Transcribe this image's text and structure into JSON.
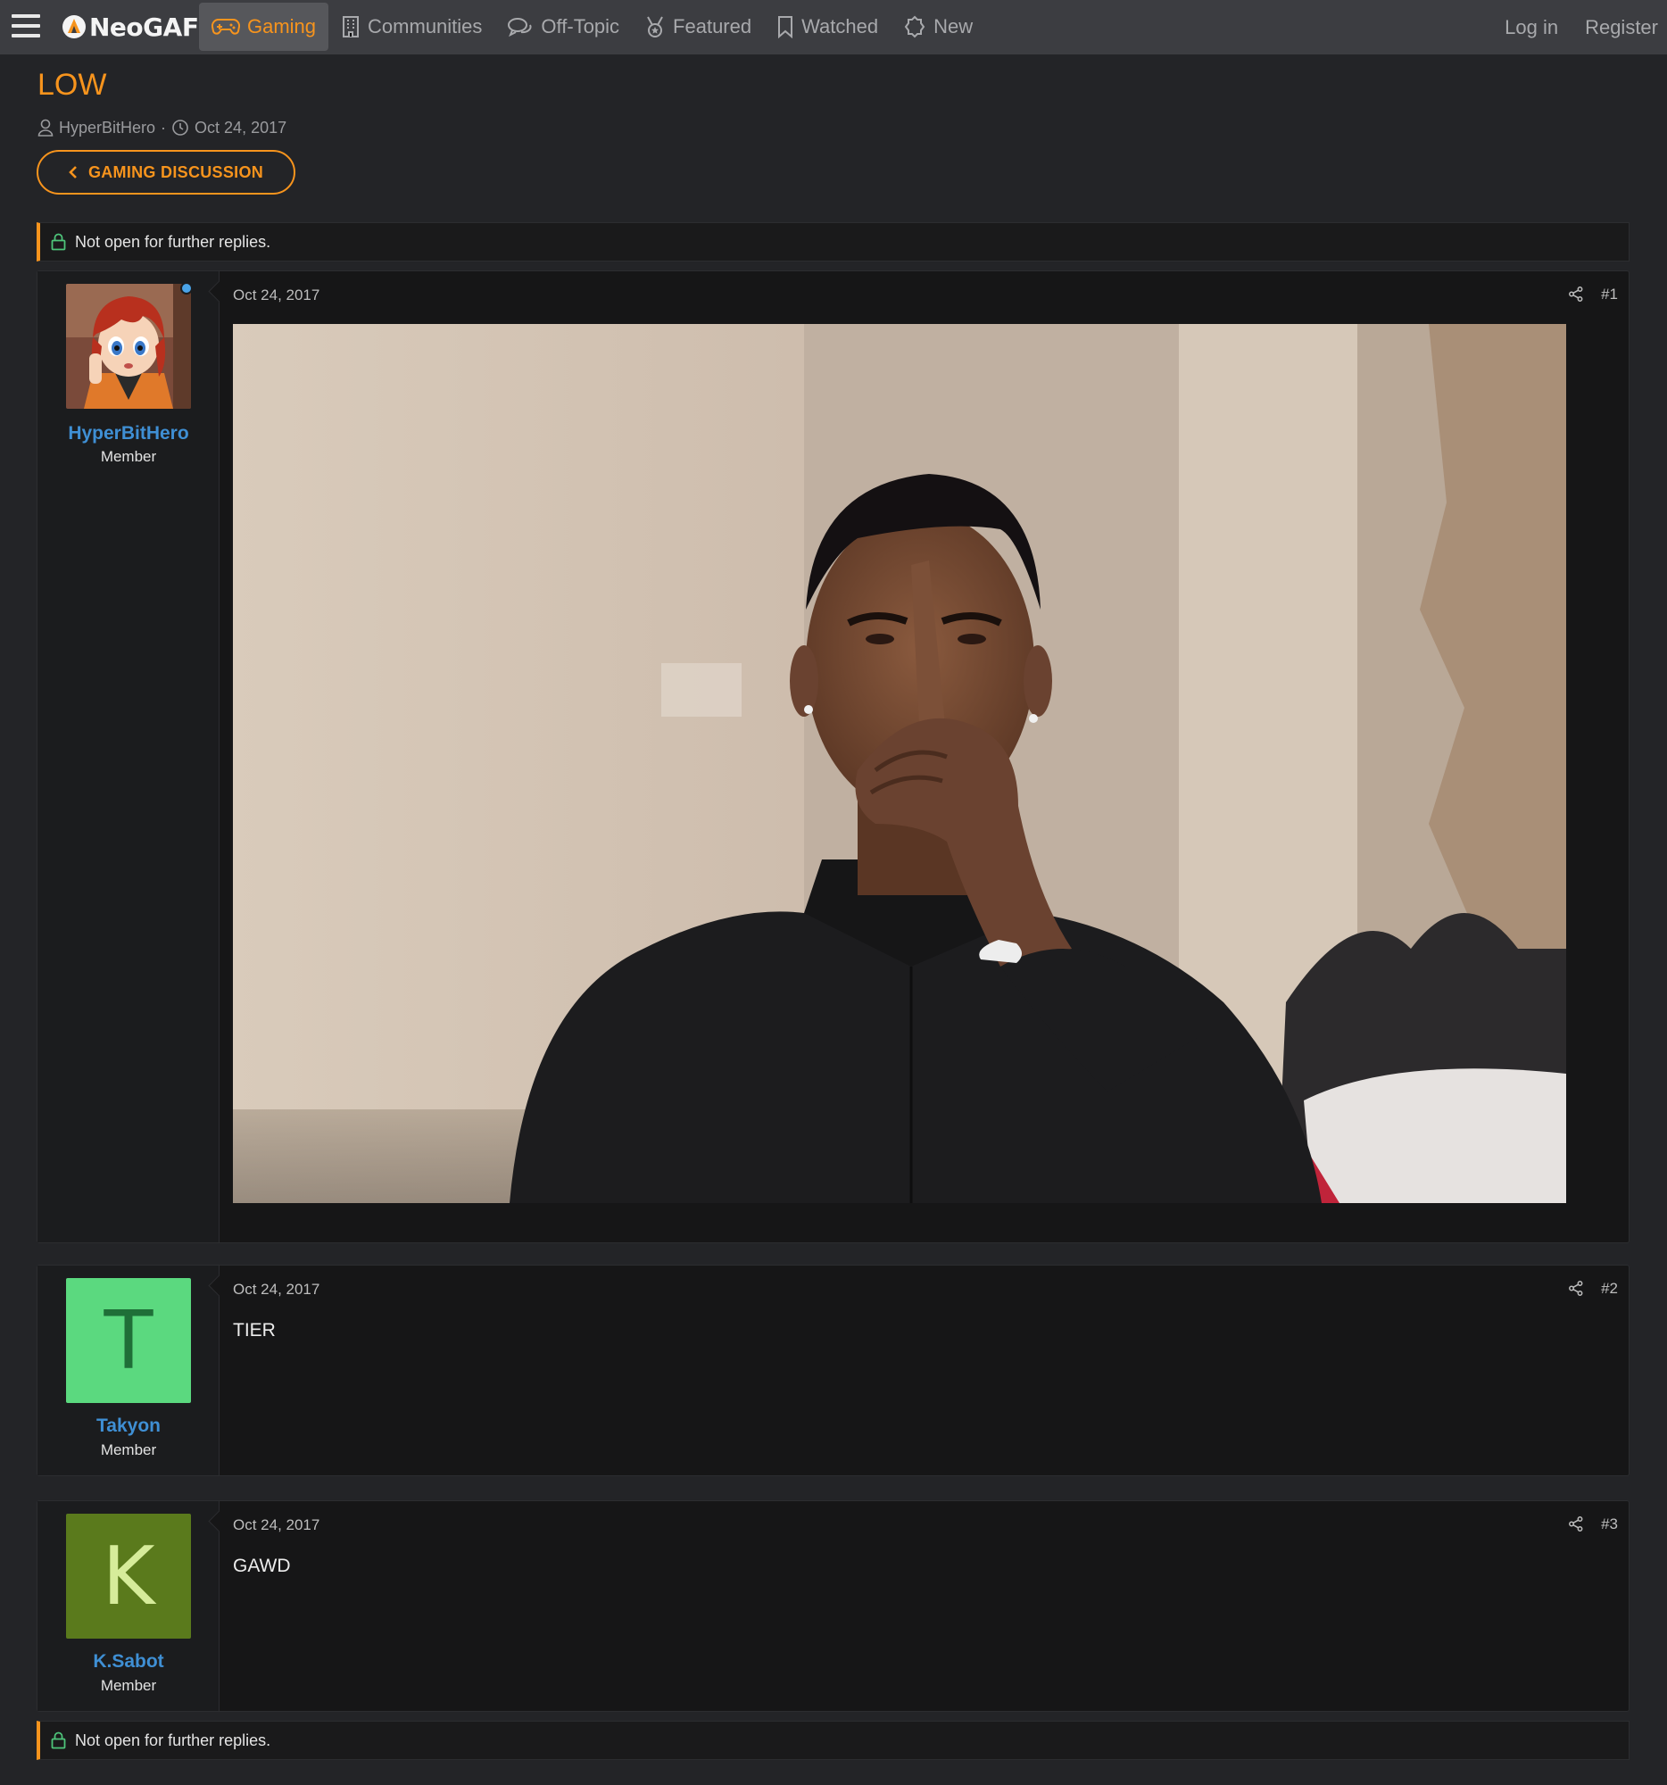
{
  "nav": {
    "logo_text": "NeoGAF",
    "tabs": [
      {
        "label": "Gaming",
        "icon": "gamepad-icon"
      },
      {
        "label": "Communities",
        "icon": "building-icon"
      },
      {
        "label": "Off-Topic",
        "icon": "chat-bubbles-icon"
      },
      {
        "label": "Featured",
        "icon": "medal-icon"
      },
      {
        "label": "Watched",
        "icon": "bookmark-icon"
      },
      {
        "label": "New",
        "icon": "new-badge-icon"
      }
    ],
    "login": "Log in",
    "register": "Register"
  },
  "thread": {
    "title": "LOW",
    "author": "HyperBitHero",
    "separator": "·",
    "date": "Oct 24, 2017",
    "back_label": "GAMING DISCUSSION"
  },
  "notice": {
    "text": "Not open for further replies."
  },
  "posts": [
    {
      "username": "HyperBitHero",
      "user_title": "Member",
      "date": "Oct 24, 2017",
      "number": "#1",
      "content_type": "image"
    },
    {
      "username": "Takyon",
      "user_title": "Member",
      "avatar_letter": "T",
      "avatar_bg": "#5bd97f",
      "avatar_fg": "#1f6f38",
      "date": "Oct 24, 2017",
      "number": "#2",
      "text": "TIER"
    },
    {
      "username": "K.Sabot",
      "user_title": "Member",
      "avatar_letter": "K",
      "avatar_bg": "#5a7a1c",
      "avatar_fg": "#d6ec9a",
      "date": "Oct 24, 2017",
      "number": "#3",
      "text": "GAWD"
    }
  ],
  "colors": {
    "accent": "#f7941d",
    "username": "#3f8fd4",
    "background": "#232427",
    "navbar": "#3c3d41",
    "online": "#4aa3e8"
  }
}
